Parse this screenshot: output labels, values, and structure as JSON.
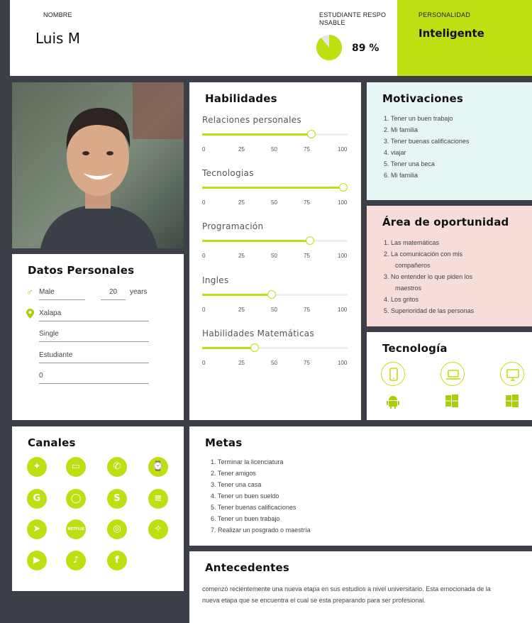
{
  "header": {
    "name_label": "NOMBRE",
    "name": "Luis M",
    "responsible_label": "ESTUDIANTE RESPO NSABLE",
    "responsible_value": 89,
    "responsible_text": "89 %",
    "personality_label": "PERSONALIDAD",
    "personality_value": "Inteligente"
  },
  "datos": {
    "title": "Datos Personales",
    "gender": "Male",
    "age": "20",
    "age_unit": "years",
    "city": "Xalapa",
    "status": "Single",
    "occupation": "Estudiante",
    "extra": "0"
  },
  "habilidades": {
    "title": "Habilidades",
    "scale": [
      "0",
      "25",
      "50",
      "75",
      "100"
    ],
    "items": [
      {
        "label": "Relaciones personales",
        "value": 75
      },
      {
        "label": "Tecnologias",
        "value": 97
      },
      {
        "label": "Programación",
        "value": 74
      },
      {
        "label": "Ingles",
        "value": 48
      },
      {
        "label": "Habilidades Matemáticas",
        "value": 36
      }
    ]
  },
  "motivaciones": {
    "title": "Motivaciones",
    "items": [
      "1. Tener un buen trabajo",
      "2. Mi familia",
      "3. Tener buenas calificaciones",
      "4. viajar",
      "5. Tener una beca",
      "6. Mi familia"
    ]
  },
  "oportunidad": {
    "title": "Área de oportunidad",
    "items": [
      "1. Las matemáticas",
      "2. La comunicación con mis",
      "compañeros",
      "3. No entender lo que piden los",
      "maestros",
      "4. Los gritos",
      "5. Superioridad de las personas"
    ]
  },
  "tecnologia": {
    "title": "Tecnología",
    "devices": [
      "phone-icon",
      "laptop-icon",
      "desktop-icon"
    ],
    "os": [
      "android-icon",
      "windows-icon",
      "windows-icon"
    ]
  },
  "canales": {
    "title": "Canales",
    "icons": [
      "gamepad-icon",
      "laptop-icon",
      "phone-icon",
      "watch-icon",
      "google-icon",
      "whatsapp-icon",
      "skype-icon",
      "spotify-icon",
      "telegram-icon",
      "netflix-icon",
      "instagram-icon",
      "twitter-icon",
      "youtube-icon",
      "tiktok-icon",
      "facebook-icon"
    ],
    "netflix_text": "NETFLIX"
  },
  "metas": {
    "title": "Metas",
    "items": [
      "1.  Terminar la licenciatura",
      "2. Tener amigos",
      "3. Tener una casa",
      "4. Tener un buen sueldo",
      "5. Tener buenas calificaciones",
      "6. Tener un buen trabajo",
      "7. Realizar un posgrado o maestría"
    ]
  },
  "antecedentes": {
    "title": "Antecedentes",
    "text": "comenzó recientemente una nueva etapa en sus estudios a nivel universitario. Esta emocionada de la nueva etapa que se encuentra el cual se esta preparando para ser profesional."
  },
  "colors": {
    "accent": "#bfdf12",
    "mint": "#e5f6f4",
    "rose": "#f7ddd9",
    "background": "#3c3f47"
  }
}
